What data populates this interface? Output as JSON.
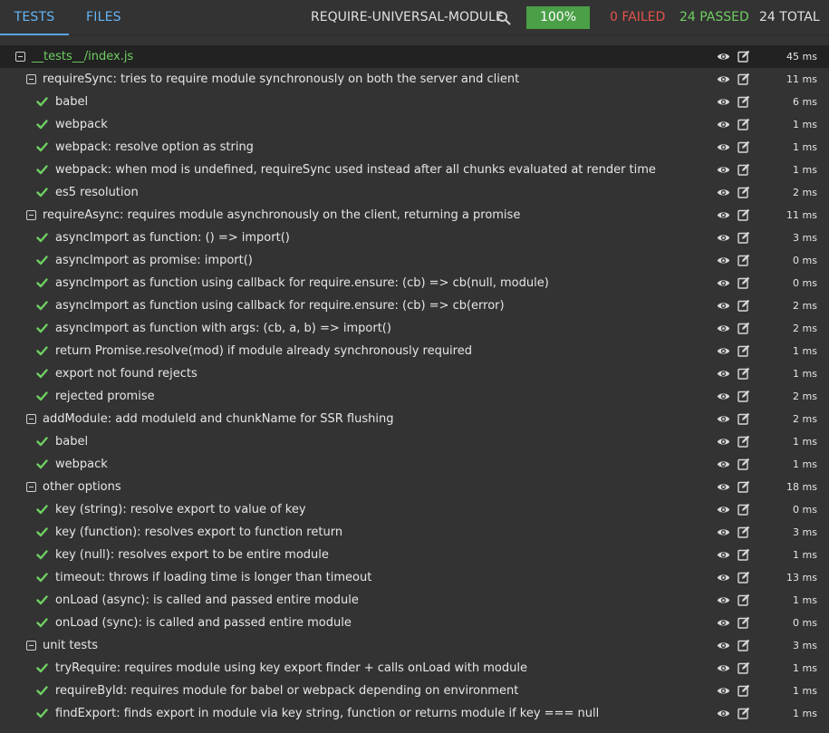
{
  "header": {
    "tab_tests": "TESTS",
    "tab_files": "FILES",
    "suite": "REQUIRE-UNIVERSAL-MODULE",
    "progress": "100%",
    "failed": "0 FAILED",
    "passed": "24 PASSED",
    "total": "24 TOTAL"
  },
  "colors": {
    "accent": "#64b5f6",
    "pass": "#6fcf62",
    "fail": "#e5534b",
    "progress_bg": "#4a9f47"
  },
  "rows": [
    {
      "kind": "file",
      "level": 0,
      "label": "__tests__/index.js",
      "duration": "45 ms"
    },
    {
      "kind": "group",
      "level": 1,
      "label": "requireSync: tries to require module synchronously on both the server and client",
      "duration": "11 ms"
    },
    {
      "kind": "test",
      "level": 2,
      "label": "babel",
      "duration": "6 ms"
    },
    {
      "kind": "test",
      "level": 2,
      "label": "webpack",
      "duration": "1 ms"
    },
    {
      "kind": "test",
      "level": 2,
      "label": "webpack: resolve option as string",
      "duration": "1 ms"
    },
    {
      "kind": "test",
      "level": 2,
      "label": "webpack: when mod is undefined, requireSync used instead after all chunks evaluated at render time",
      "duration": "1 ms"
    },
    {
      "kind": "test",
      "level": 2,
      "label": "es5 resolution",
      "duration": "2 ms"
    },
    {
      "kind": "group",
      "level": 1,
      "label": "requireAsync: requires module asynchronously on the client, returning a promise",
      "duration": "11 ms"
    },
    {
      "kind": "test",
      "level": 2,
      "label": "asyncImport as function: () => import()",
      "duration": "3 ms"
    },
    {
      "kind": "test",
      "level": 2,
      "label": "asyncImport as promise: import()",
      "duration": "0 ms"
    },
    {
      "kind": "test",
      "level": 2,
      "label": "asyncImport as function using callback for require.ensure: (cb) => cb(null, module)",
      "duration": "0 ms"
    },
    {
      "kind": "test",
      "level": 2,
      "label": "asyncImport as function using callback for require.ensure: (cb) => cb(error)",
      "duration": "2 ms"
    },
    {
      "kind": "test",
      "level": 2,
      "label": "asyncImport as function with args: (cb, a, b) => import()",
      "duration": "2 ms"
    },
    {
      "kind": "test",
      "level": 2,
      "label": "return Promise.resolve(mod) if module already synchronously required",
      "duration": "1 ms"
    },
    {
      "kind": "test",
      "level": 2,
      "label": "export not found rejects",
      "duration": "1 ms"
    },
    {
      "kind": "test",
      "level": 2,
      "label": "rejected promise",
      "duration": "2 ms"
    },
    {
      "kind": "group",
      "level": 1,
      "label": "addModule: add moduleId and chunkName for SSR flushing",
      "duration": "2 ms"
    },
    {
      "kind": "test",
      "level": 2,
      "label": "babel",
      "duration": "1 ms"
    },
    {
      "kind": "test",
      "level": 2,
      "label": "webpack",
      "duration": "1 ms"
    },
    {
      "kind": "group",
      "level": 1,
      "label": "other options",
      "duration": "18 ms"
    },
    {
      "kind": "test",
      "level": 2,
      "label": "key (string): resolve export to value of key",
      "duration": "0 ms"
    },
    {
      "kind": "test",
      "level": 2,
      "label": "key (function): resolves export to function return",
      "duration": "3 ms"
    },
    {
      "kind": "test",
      "level": 2,
      "label": "key (null): resolves export to be entire module",
      "duration": "1 ms"
    },
    {
      "kind": "test",
      "level": 2,
      "label": "timeout: throws if loading time is longer than timeout",
      "duration": "13 ms"
    },
    {
      "kind": "test",
      "level": 2,
      "label": "onLoad (async): is called and passed entire module",
      "duration": "1 ms"
    },
    {
      "kind": "test",
      "level": 2,
      "label": "onLoad (sync): is called and passed entire module",
      "duration": "0 ms"
    },
    {
      "kind": "group",
      "level": 1,
      "label": "unit tests",
      "duration": "3 ms"
    },
    {
      "kind": "test",
      "level": 2,
      "label": "tryRequire: requires module using key export finder + calls onLoad with module",
      "duration": "1 ms"
    },
    {
      "kind": "test",
      "level": 2,
      "label": "requireById: requires module for babel or webpack depending on environment",
      "duration": "1 ms"
    },
    {
      "kind": "test",
      "level": 2,
      "label": "findExport: finds export in module via key string, function or returns module if key === null",
      "duration": "1 ms"
    }
  ]
}
